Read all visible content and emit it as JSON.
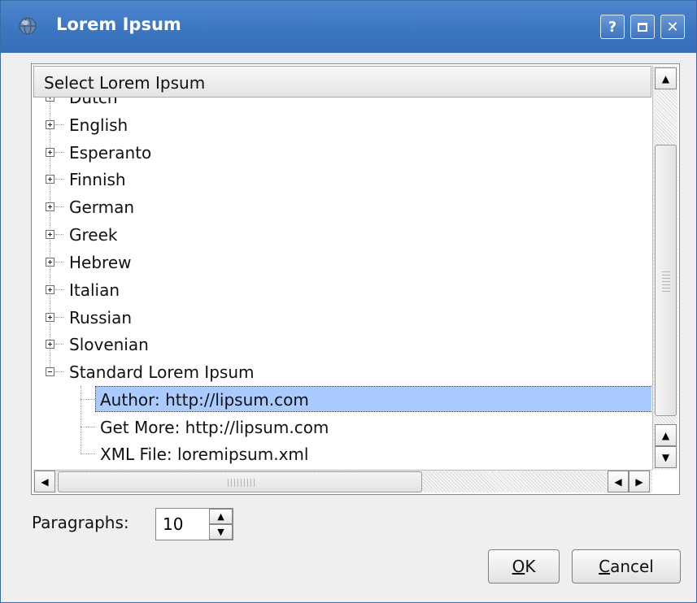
{
  "window": {
    "title": "Lorem Ipsum",
    "help_label": "?",
    "maximize_label": "",
    "close_label": "✕"
  },
  "tree": {
    "header": "Select Lorem Ipsum",
    "partial_top_item": "Dutch",
    "items": [
      {
        "label": "English",
        "expanded": false
      },
      {
        "label": "Esperanto",
        "expanded": false
      },
      {
        "label": "Finnish",
        "expanded": false
      },
      {
        "label": "German",
        "expanded": false
      },
      {
        "label": "Greek",
        "expanded": false
      },
      {
        "label": "Hebrew",
        "expanded": false
      },
      {
        "label": "Italian",
        "expanded": false
      },
      {
        "label": "Russian",
        "expanded": false
      },
      {
        "label": "Slovenian",
        "expanded": false
      },
      {
        "label": "Standard Lorem Ipsum",
        "expanded": true
      }
    ],
    "children": [
      {
        "label": "Author: http://lipsum.com",
        "selected": true
      },
      {
        "label": "Get More: http://lipsum.com",
        "selected": false
      },
      {
        "label": "XML File: loremipsum.xml",
        "selected": false
      }
    ]
  },
  "scroll": {
    "up_arrow": "▲",
    "down_arrow": "▼",
    "left_arrow": "◀",
    "right_arrow": "▶"
  },
  "paragraphs": {
    "label": "Paragraphs:",
    "value": "10"
  },
  "buttons": {
    "ok_mnemonic": "O",
    "ok_rest": "K",
    "cancel_mnemonic": "C",
    "cancel_rest": "ancel"
  },
  "colors": {
    "titlebar": "#3f79c3",
    "selection": "#a9cbff",
    "dialog_bg": "#efefef"
  }
}
